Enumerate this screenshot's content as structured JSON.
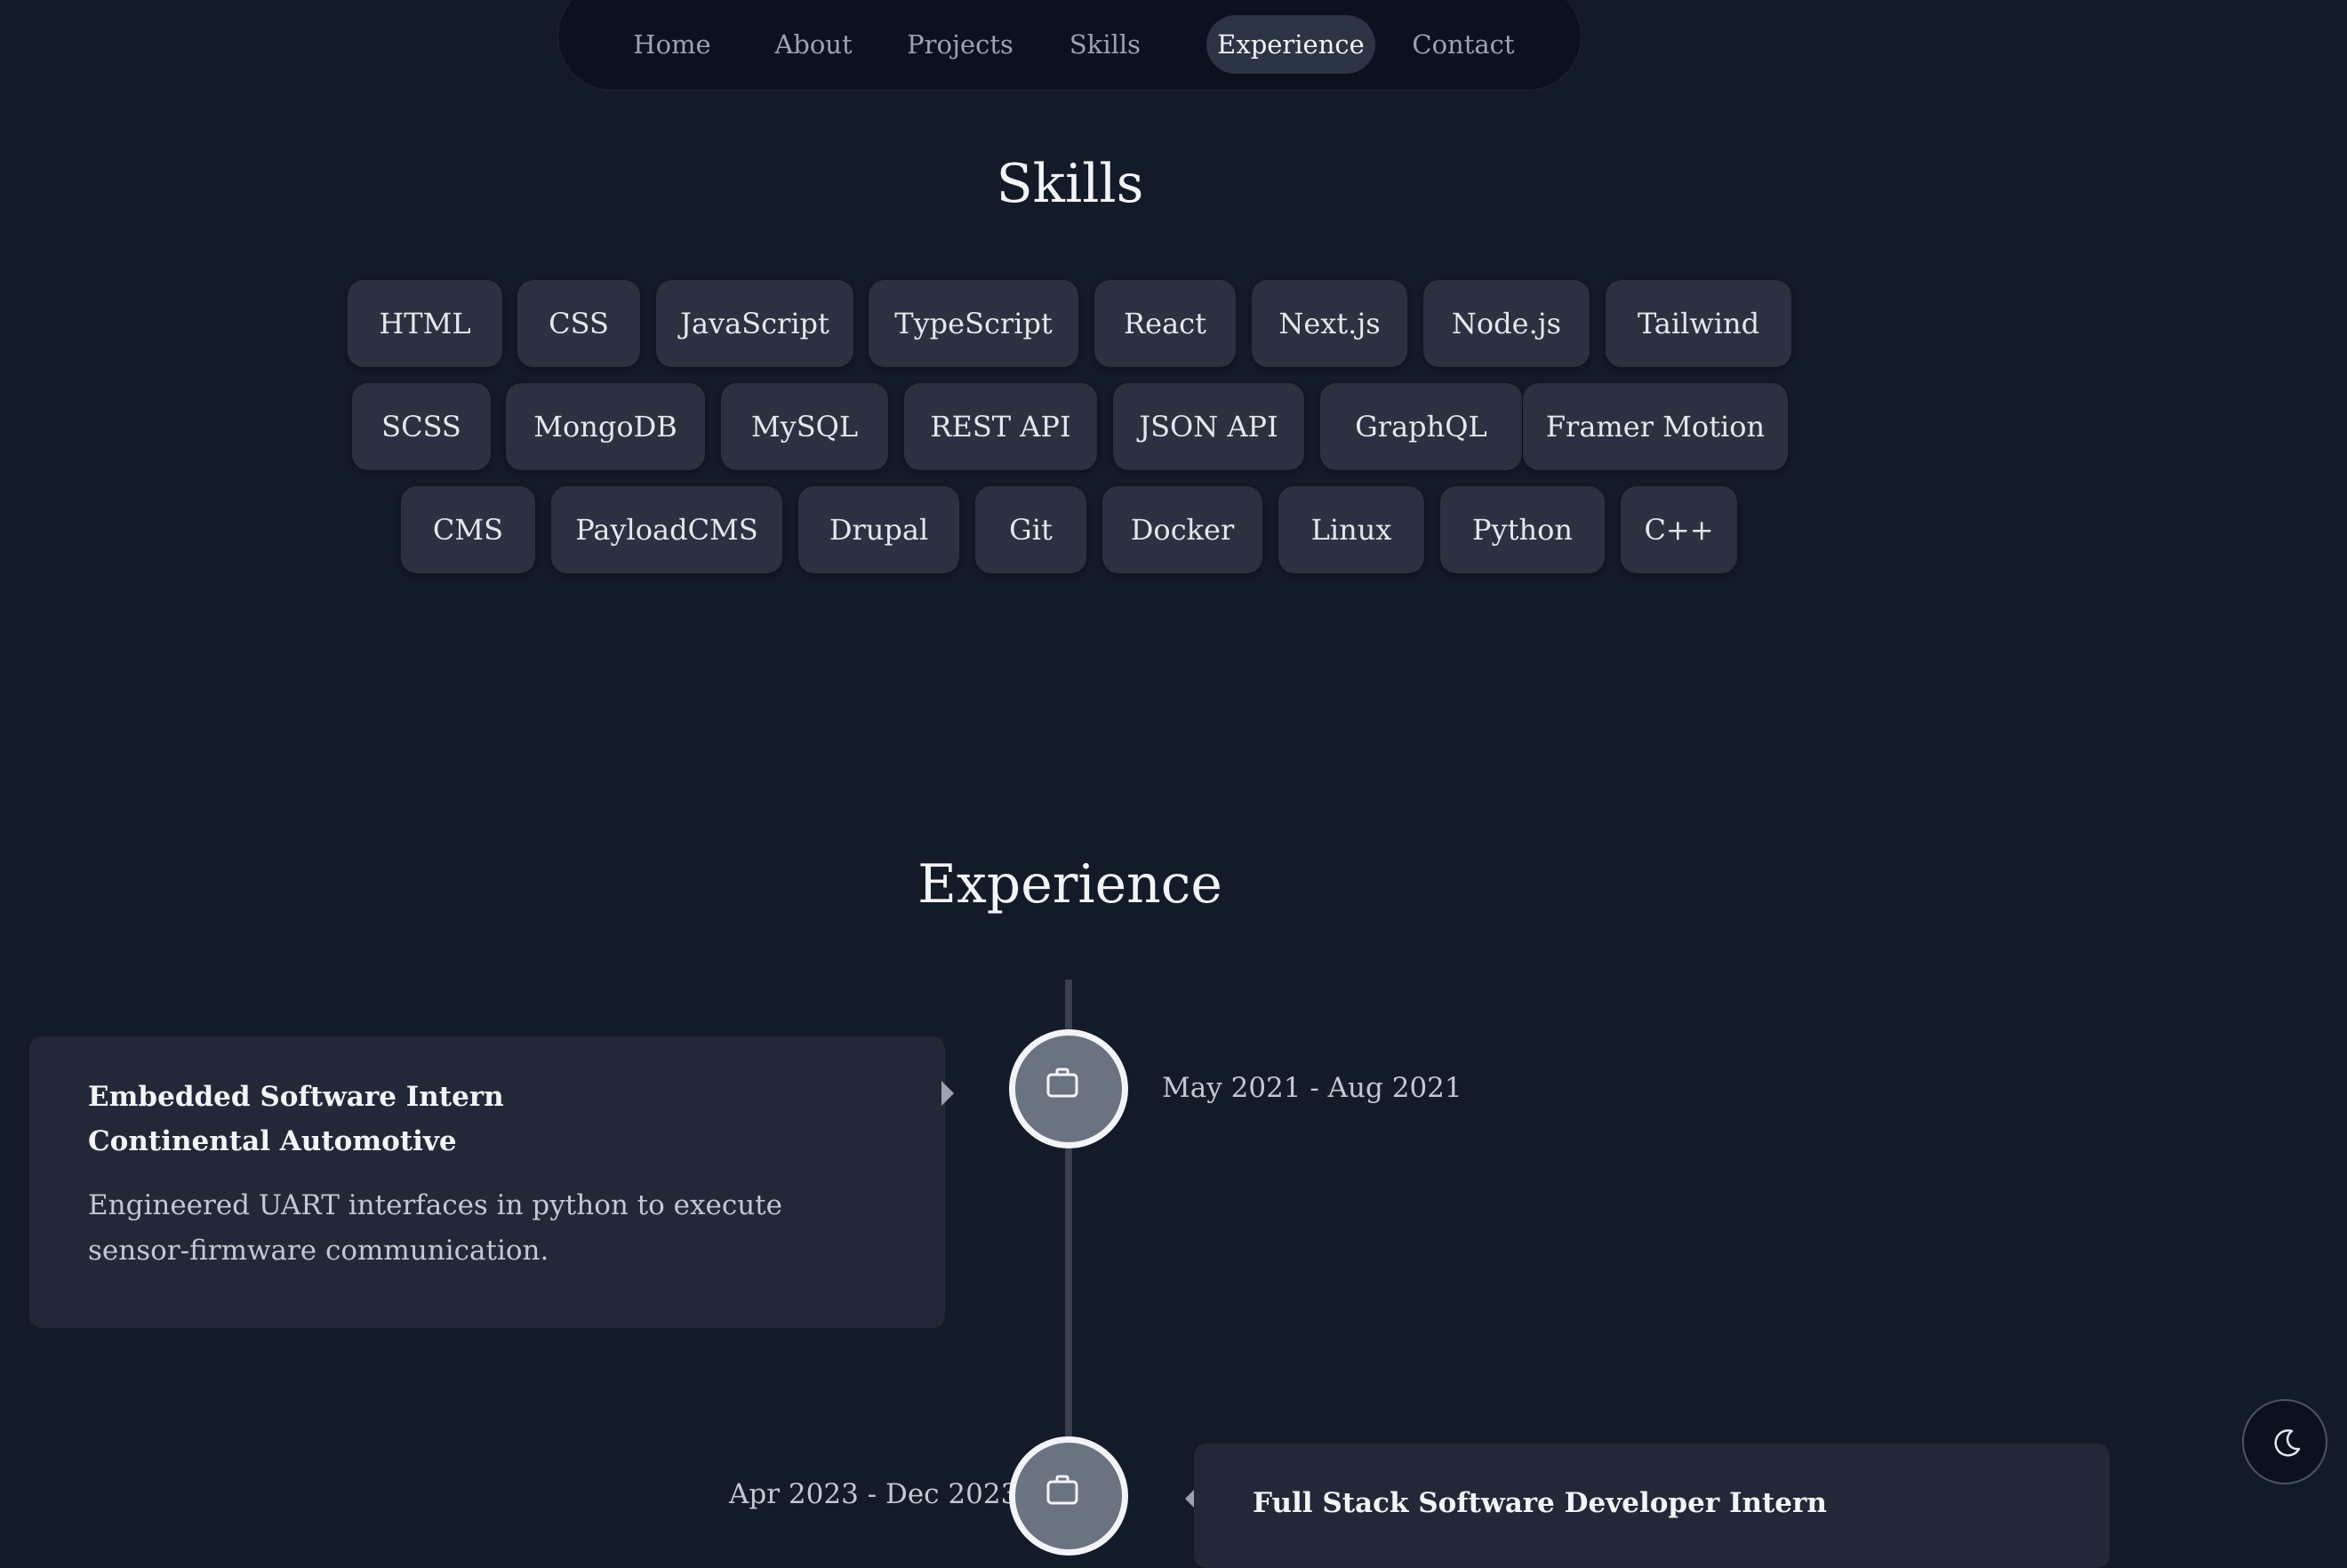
{
  "nav": {
    "items": [
      {
        "label": "Home"
      },
      {
        "label": "About"
      },
      {
        "label": "Projects"
      },
      {
        "label": "Skills"
      },
      {
        "label": "Experience",
        "active": true
      },
      {
        "label": "Contact"
      }
    ]
  },
  "skills": {
    "title": "Skills",
    "rows": [
      [
        "HTML",
        "CSS",
        "JavaScript",
        "TypeScript",
        "React",
        "Next.js",
        "Node.js",
        "Tailwind"
      ],
      [
        "SCSS",
        "MongoDB",
        "MySQL",
        "REST API",
        "JSON API",
        "GraphQL",
        "Framer Motion"
      ],
      [
        "CMS",
        "PayloadCMS",
        "Drupal",
        "Git",
        "Docker",
        "Linux",
        "Python",
        "C++"
      ]
    ]
  },
  "experience": {
    "title": "Experience",
    "items": [
      {
        "role": "Embedded Software Intern",
        "company": "Continental Automotive",
        "description": "Engineered UART interfaces in python to execute sensor-firmware communication.",
        "date": "May 2021 - Aug 2021",
        "icon": "briefcase-icon"
      },
      {
        "role": "Full Stack Software Developer Intern",
        "date": "Apr 2023 - Dec 2023",
        "icon": "briefcase-icon"
      }
    ]
  },
  "theme_toggle": {
    "icon": "moon-icon"
  },
  "colors": {
    "background": "#131a28",
    "nav_background": "#0c1120",
    "chip_background": "#2b3140",
    "card_background": "#222838",
    "active_pill": "#2b3344"
  }
}
